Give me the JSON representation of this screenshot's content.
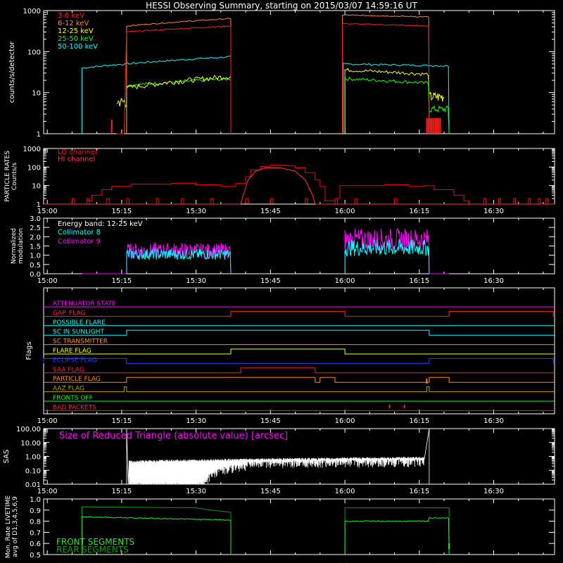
{
  "title": "HESSI Observing Summary, starting on 2015/03/07 14:59:16 UT",
  "time_ticks": [
    "15:00",
    "15:15",
    "15:30",
    "15:45",
    "16:00",
    "16:15",
    "16:30"
  ],
  "colors": {
    "c36": "#ff2020",
    "c612": "#ff8c1a",
    "c1225": "#ffff00",
    "c2550": "#00ff00",
    "c50100": "#00ffff",
    "lo": "#ff0000",
    "hi": "#ff3050",
    "coll8": "#00ffff",
    "coll9": "#ff00ff",
    "sas": "#ff00ff",
    "front": "#22ee22",
    "rear": "#119911"
  },
  "panels": {
    "rates": {
      "ylabel": "counts/s/detector",
      "yticks": [
        "1",
        "10",
        "100",
        "1000"
      ],
      "legend": [
        "3-6 keV",
        "6-12 keV",
        "12-25 keV",
        "25-50 keV",
        "50-100 keV"
      ]
    },
    "particle": {
      "ylabel1": "PARTICLE RATES",
      "ylabel2": "Counts/s",
      "yticks": [
        "1",
        "10",
        "100",
        "1000"
      ],
      "legend": [
        "LO channel",
        "HI channel"
      ]
    },
    "modulation": {
      "ylabel1": "Normalized",
      "ylabel2": "modulation",
      "yticks": [
        "0.0",
        "0.5",
        "1.0",
        "1.5",
        "2.0",
        "2.5",
        "3.0"
      ],
      "legend": [
        "Energy band: 12-25 keV",
        "Collimator 8",
        "Collimator 9"
      ]
    },
    "flags": {
      "ylabel": "Flags",
      "items": [
        {
          "label": "ATTENUATOR STATE",
          "color": "#ff00ff"
        },
        {
          "label": "GAP_FLAG",
          "color": "#ff2020"
        },
        {
          "label": "POSSIBLE FLARE",
          "color": "#00ffff"
        },
        {
          "label": "SC IN SUNLIGHT",
          "color": "#00ffff"
        },
        {
          "label": "SC TRANSMITTER",
          "color": "#ff8c1a"
        },
        {
          "label": "FLARE FLAG",
          "color": "#ffff00"
        },
        {
          "label": "ECLIPSE FLAG",
          "color": "#2040ff"
        },
        {
          "label": "SAA FLAG",
          "color": "#ff2020"
        },
        {
          "label": "PARTICLE FLAG",
          "color": "#ff8c1a"
        },
        {
          "label": "AAZ FLAG",
          "color": "#b8a000"
        },
        {
          "label": "FRONTS OFF",
          "color": "#00ff00"
        },
        {
          "label": "BAD PACKETS",
          "color": "#ff2020"
        }
      ]
    },
    "sas": {
      "ylabel": "SAS",
      "yticks": [
        "0.01",
        "0.10",
        "1.00",
        "10.00",
        "100.00"
      ],
      "legend": "Size of Reduced Triangle (absolute value) [arcsec]"
    },
    "livetime": {
      "ylabel1": "Mon. Rate LIVETIME",
      "ylabel2": "avg of D1,3,4,5,6,9",
      "yticks": [
        "0.5",
        "0.6",
        "0.7",
        "0.8",
        "0.9",
        "1.0"
      ],
      "legend": [
        "FRONT SEGMENTS",
        "REAR SEGMENTS"
      ]
    }
  },
  "chart_data": [
    {
      "type": "line",
      "panel": "rates",
      "ylog": true,
      "ylim": [
        1,
        1000
      ],
      "xlim": [
        "14:59:16",
        "16:42"
      ],
      "series": [
        {
          "name": "3-6 keV",
          "points": [
            [
              "15:07:00",
              1
            ],
            [
              "15:14:00",
              1
            ],
            [
              "15:16:00",
              300
            ],
            [
              "15:37:00",
              400
            ],
            [
              "15:37:30",
              1
            ],
            [
              "15:59:30",
              1
            ],
            [
              "16:00:00",
              450
            ],
            [
              "16:17:00",
              400
            ],
            [
              "16:17:30",
              1
            ]
          ]
        },
        {
          "name": "6-12 keV",
          "points": [
            [
              "15:16:00",
              400
            ],
            [
              "15:30:00",
              500
            ],
            [
              "15:37:00",
              650
            ],
            [
              "16:00:00",
              750
            ],
            [
              "16:17:00",
              700
            ]
          ]
        },
        {
          "name": "12-25 keV",
          "points": [
            [
              "15:14:00",
              6
            ],
            [
              "15:16:00",
              14
            ],
            [
              "15:30:00",
              18
            ],
            [
              "15:37:00",
              25
            ],
            [
              "16:00:00",
              35
            ],
            [
              "16:17:00",
              20
            ],
            [
              "16:20:00",
              8
            ]
          ]
        },
        {
          "name": "25-50 keV",
          "points": [
            [
              "15:16:00",
              15
            ],
            [
              "15:30:00",
              18
            ],
            [
              "15:37:00",
              22
            ],
            [
              "16:00:00",
              22
            ],
            [
              "16:17:00",
              17
            ],
            [
              "16:21:00",
              4
            ]
          ]
        },
        {
          "name": "50-100 keV",
          "points": [
            [
              "15:07:00",
              40
            ],
            [
              "15:30:00",
              45
            ],
            [
              "15:37:00",
              75
            ],
            [
              "16:00:00",
              50
            ],
            [
              "16:21:00",
              45
            ]
          ]
        }
      ]
    },
    {
      "type": "line",
      "panel": "particle",
      "ylog": true,
      "ylim": [
        1,
        1000
      ],
      "series": [
        {
          "name": "LO channel",
          "points": [
            [
              "15:10:00",
              2
            ],
            [
              "15:30:00",
              11
            ],
            [
              "15:45:00",
              120
            ],
            [
              "15:56:00",
              2
            ],
            [
              "16:00:00",
              10
            ],
            [
              "16:15:00",
              10
            ],
            [
              "16:25:00",
              1
            ]
          ]
        },
        {
          "name": "HI channel",
          "points": [
            [
              "15:39:00",
              1
            ],
            [
              "15:45:00",
              100
            ],
            [
              "15:54:00",
              1
            ]
          ]
        }
      ]
    },
    {
      "type": "line",
      "panel": "modulation",
      "ylim": [
        0,
        3
      ],
      "series": [
        {
          "name": "Collimator 8",
          "points": [
            [
              "15:16:00",
              1.0
            ],
            [
              "15:37:00",
              1.1
            ],
            [
              "16:00:00",
              1.4
            ],
            [
              "16:17:00",
              1.2
            ]
          ]
        },
        {
          "name": "Collimator 9",
          "points": [
            [
              "15:16:00",
              1.2
            ],
            [
              "15:37:00",
              1.3
            ],
            [
              "16:00:00",
              1.8
            ],
            [
              "16:17:00",
              1.7
            ]
          ]
        }
      ]
    },
    {
      "type": "line",
      "panel": "sas",
      "ylog": true,
      "ylim": [
        0.01,
        100
      ],
      "series": [
        {
          "name": "Size of Reduced Triangle",
          "points": [
            [
              "15:16:00",
              100
            ],
            [
              "15:17:00",
              0.3
            ],
            [
              "15:30:00",
              0.2
            ],
            [
              "15:45:00",
              0.5
            ],
            [
              "16:00:00",
              0.6
            ],
            [
              "16:16:00",
              0.6
            ],
            [
              "16:17:00",
              100
            ]
          ]
        }
      ]
    },
    {
      "type": "line",
      "panel": "livetime",
      "ylim": [
        0.5,
        1.0
      ],
      "series": [
        {
          "name": "FRONT SEGMENTS",
          "points": [
            [
              "15:07:00",
              0.84
            ],
            [
              "15:37:00",
              0.82
            ],
            [
              "16:00:00",
              0.8
            ],
            [
              "16:17:00",
              0.83
            ]
          ]
        },
        {
          "name": "REAR SEGMENTS",
          "points": [
            [
              "15:07:00",
              0.93
            ],
            [
              "15:30:00",
              0.92
            ],
            [
              "15:37:00",
              0.88
            ],
            [
              "16:00:00",
              0.91
            ],
            [
              "16:21:00",
              0.92
            ]
          ]
        }
      ]
    }
  ]
}
